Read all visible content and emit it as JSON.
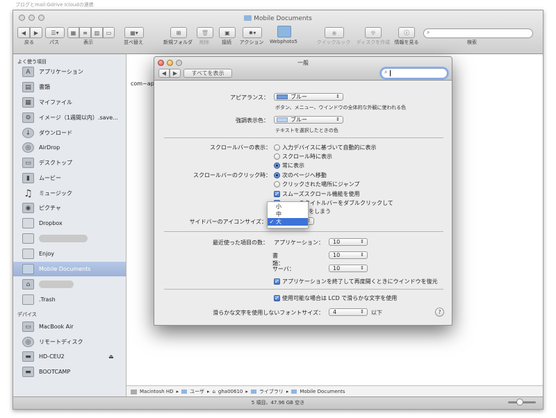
{
  "desktop_text": "ブログとmail:Gdrive Icloudの連携",
  "finder": {
    "title": "Mobile Documents",
    "toolbar": {
      "back_label": "戻る",
      "path_label": "パス",
      "view_label": "表示",
      "arrange_label": "並べ替え",
      "new_folder_label": "新規フォルダ",
      "delete_label": "削除",
      "connect_label": "接続",
      "action_label": "アクション",
      "webphoto_label": "Webphoto5",
      "quicklook_label": "クイックルック",
      "burn_label": "ディスクを作成",
      "info_label": "情報を見る",
      "search_label": "検索"
    },
    "sidebar": {
      "favorites_header": "よく使う項目",
      "items": [
        {
          "label": "アプリケーション",
          "icon": "A"
        },
        {
          "label": "書類",
          "icon": "▤"
        },
        {
          "label": "マイファイル",
          "icon": "▦"
        },
        {
          "label": "イメージ（1週間以内）.save...",
          "icon": "⚙"
        },
        {
          "label": "ダウンロード",
          "icon": "↓"
        },
        {
          "label": "AirDrop",
          "icon": "◎"
        },
        {
          "label": "デスクトップ",
          "icon": "▭"
        },
        {
          "label": "ムービー",
          "icon": "▮"
        },
        {
          "label": "ミュージック",
          "icon": "♫"
        },
        {
          "label": "ピクチャ",
          "icon": "◉"
        },
        {
          "label": "Dropbox",
          "icon": ""
        },
        {
          "label": "",
          "icon": ""
        },
        {
          "label": "Enjoy",
          "icon": ""
        },
        {
          "label": "Mobile Documents",
          "icon": ""
        },
        {
          "label": "",
          "icon": "⌂"
        },
        {
          "label": ".Trash",
          "icon": ""
        }
      ],
      "devices_header": "デバイス",
      "devices": [
        {
          "label": "MacBook Air",
          "icon": "▭"
        },
        {
          "label": "リモートディスク",
          "icon": "◎"
        },
        {
          "label": "HD-CEU2",
          "icon": "▬",
          "eject": "⏏"
        },
        {
          "label": "BOOTCAMP",
          "icon": "▬"
        }
      ]
    },
    "content_item": "com~ap",
    "path": [
      "Macintosh HD",
      "ユーザ",
      "gha00610",
      "ライブラリ",
      "Mobile Documents"
    ],
    "status": "5 項目、47.96 GB 空き"
  },
  "prefs": {
    "title": "一般",
    "show_all": "すべてを表示",
    "appearance_label": "アピアランス：",
    "appearance_value": "ブルー",
    "appearance_desc": "ボタン、メニュー、ウインドウの全体的な外観に使われる色",
    "highlight_label": "強調表示色：",
    "highlight_value": "ブルー",
    "highlight_desc": "テキストを選択したときの色",
    "scrollbar_label": "スクロールバーの表示：",
    "scrollbar_options": [
      "入力デバイスに基づいて自動的に表示",
      "スクロール時に表示",
      "常に表示"
    ],
    "scrollbar_selected": 2,
    "click_label": "スクロールバーのクリック時：",
    "click_options": [
      "次のページへ移動",
      "クリックされた場所にジャンプ"
    ],
    "click_selected": 0,
    "smooth_scroll": "スムーズスクロール機能を使用",
    "doubleclick_line1": "のタイトルバーをダブルクリックして",
    "doubleclick_line2": "をしまう",
    "sidebar_icon_label": "サイドバーのアイコンサイズ：",
    "sidebar_icon_menu": [
      {
        "label": "小",
        "selected": false
      },
      {
        "label": "中",
        "selected": false
      },
      {
        "label": "大",
        "selected": true
      }
    ],
    "recent_label": "最近使った項目の数：",
    "recent_apps_label": "アプリケーション：",
    "recent_apps": "10",
    "recent_docs_label": "書類：",
    "recent_docs": "10",
    "recent_servers_label": "サーバ：",
    "recent_servers": "10",
    "restore_windows": "アプリケーションを終了して再度開くときにウインドウを復元",
    "lcd_smoothing": "使用可能な場合は LCD で滑らかな文字を使用",
    "font_smoothing_label": "滑らかな文字を使用しないフォントサイズ：",
    "font_smoothing_value": "4",
    "font_smoothing_suffix": "以下",
    "help": "?"
  }
}
